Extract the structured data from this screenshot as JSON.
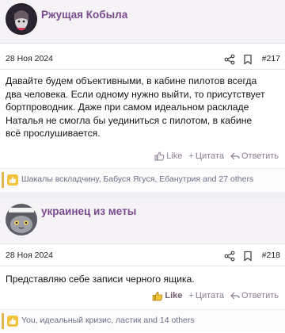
{
  "posts": [
    {
      "author": "Ржущая Кобыла",
      "date": "28 Ноя 2024",
      "number": "#217",
      "lines": [
        "Давайте будем объективными, в кабине пилотов всегда",
        "два человека. Если одному нужно выйти, то присутствует",
        "бортпроводник. Даже при самом идеальном раскладе",
        "Наталья не смогла бы уединиться с пилотом, в кабине",
        "всё прослушивается."
      ],
      "actions": {
        "like": "Like",
        "quote": "Цитата",
        "reply": "Ответить"
      },
      "reactions": "Шакалы вскладчину, Бабуся Ягуся, Ебанутрия and 27 others"
    },
    {
      "author": "украинец из меты",
      "date": "28 Ноя 2024",
      "number": "#218",
      "lines": [
        "Представляю себе записи черного ящика."
      ],
      "actions": {
        "like": "Like",
        "quote": "Цитата",
        "reply": "Ответить"
      },
      "reactions": "You, идеальный кризис, ластик and 14 others"
    }
  ],
  "colors": {
    "author": "#7b4a8f",
    "action": "#8a7d92",
    "reaction_badge": "#f0c33c",
    "reaction_text": "#6a6f86"
  },
  "icons": {
    "share": "share-icon",
    "bookmark": "bookmark-icon",
    "like": "thumbs-up-icon",
    "quote": "plus-icon",
    "reply": "reply-icon"
  }
}
